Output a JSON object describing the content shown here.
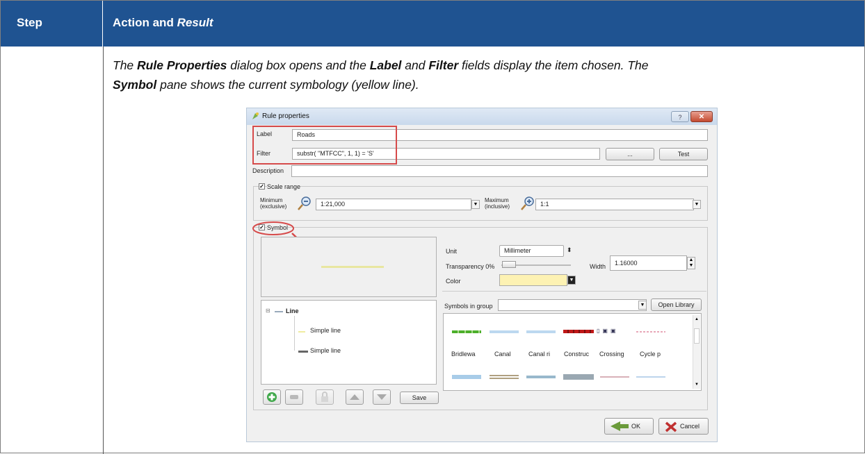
{
  "table": {
    "header": {
      "step": "Step",
      "action": "Action and",
      "result": "Result"
    },
    "description": {
      "t1": "The ",
      "rule_properties": "Rule Properties",
      "t2": " dialog box opens and the ",
      "label": "Label",
      "t3": " and ",
      "filter": "Filter",
      "t4": " fields display the item chosen. The ",
      "symbol": "Symbol",
      "t5": " pane shows the current symbology (yellow line)."
    }
  },
  "dialog": {
    "title": "Rule properties",
    "help_label": "?",
    "close_label": "✕",
    "label_caption": "Label",
    "label_value": "Roads",
    "filter_caption": "Filter",
    "filter_value": "substr( \"MTFCC\", 1, 1) = 'S'",
    "ellipsis_button": "...",
    "test_button": "Test",
    "description_caption": "Description",
    "description_value": "",
    "scale_range": {
      "title": "Scale range",
      "minimum_label_1": "Minimum",
      "minimum_label_2": "(exclusive)",
      "minimum_value": "1:21,000",
      "maximum_label_1": "Maximum",
      "maximum_label_2": "(inclusive)",
      "maximum_value": "1:1"
    },
    "symbol_group": {
      "title": "Symbol",
      "unit_label": "Unit",
      "unit_value": "Millimeter",
      "transparency_label": "Transparency 0%",
      "width_label": "Width",
      "width_value": "1.16000",
      "color_label": "Color",
      "color_value": "#fdf2b3",
      "symbols_in_group_label": "Symbols in group",
      "open_library_button": "Open Library",
      "layer_tree": {
        "root": "Line",
        "items": [
          "Simple line",
          "Simple line"
        ]
      },
      "library_items": [
        "Bridlewa",
        "Canal",
        "Canal ri",
        "Construc",
        "Crossing",
        "Cycle p"
      ],
      "save_button": "Save"
    },
    "ok_button": "OK",
    "cancel_button": "Cancel"
  },
  "colors": {
    "header_bg": "#1f5391",
    "annotation_red": "#d64a4a",
    "symbol_line": "#e8e6a0"
  }
}
